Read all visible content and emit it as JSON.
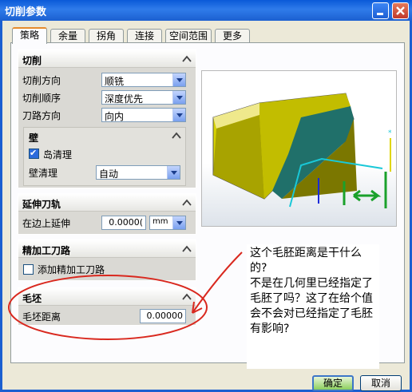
{
  "window": {
    "title": "切削参数"
  },
  "tabs": [
    {
      "label": "策略",
      "active": true
    },
    {
      "label": "余量"
    },
    {
      "label": "拐角"
    },
    {
      "label": "连接"
    },
    {
      "label": "空间范围"
    },
    {
      "label": "更多"
    }
  ],
  "cutting": {
    "header": "切削",
    "direction_label": "切削方向",
    "direction_value": "顺铣",
    "order_label": "切削顺序",
    "order_value": "深度优先",
    "pattern_label": "刀路方向",
    "pattern_value": "向内",
    "wall": {
      "header": "壁",
      "island_cleanup_label": "岛清理",
      "island_cleanup_checked": true,
      "wall_cleanup_label": "壁清理",
      "wall_cleanup_value": "自动"
    }
  },
  "extend": {
    "header": "延伸刀轨",
    "edge_extend_label": "在边上延伸",
    "edge_extend_value": "0.0000(",
    "unit_value": "mm"
  },
  "finish": {
    "header": "精加工刀路",
    "add_finish_label": "添加精加工刀路",
    "add_finish_checked": false
  },
  "blank": {
    "header": "毛坯",
    "distance_label": "毛坯距离",
    "distance_value": "0.00000"
  },
  "annotation_text": "这个毛胚距离是干什么的?\n不是在几何里已经指定了毛胚了吗？这了在给个值会不会对已经指定了毛胚有影响?",
  "buttons": {
    "ok": "确定",
    "cancel": "取消"
  },
  "colors": {
    "titlebar": "#1b5fd0",
    "annotation_circle": "#d9281e",
    "part_body": "#a8a300",
    "part_inner": "#20706a",
    "arrow_green": "#1aa12b"
  }
}
